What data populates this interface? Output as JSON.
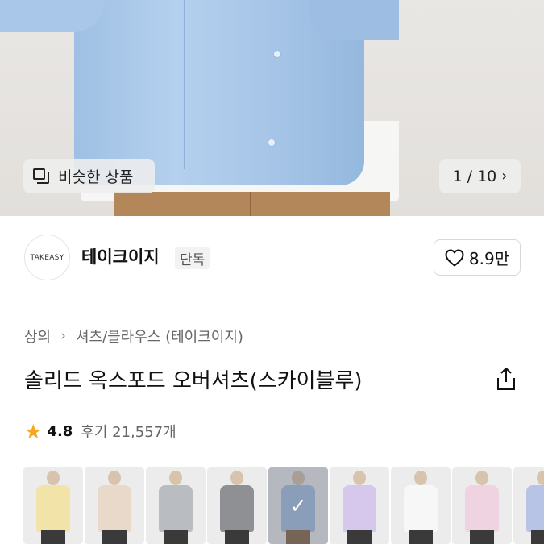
{
  "hero": {
    "similar_label": "비슷한 상품",
    "page_counter": "1 / 10"
  },
  "brand": {
    "logo_text": "TAKEASY",
    "name": "테이크이지",
    "badge": "단독",
    "likes": "8.9만"
  },
  "breadcrumb": [
    "상의",
    "셔츠/블라우스 (테이크이지)"
  ],
  "product": {
    "title": "솔리드 옥스포드 오버셔츠(스카이블루)"
  },
  "rating": {
    "value": "4.8",
    "review_text": "후기 21,557개"
  },
  "colors": {
    "accent_star": "#f5a623",
    "variants": [
      {
        "swatch": "#f2e3a8",
        "legs": "#3a3a3a",
        "selected": false
      },
      {
        "swatch": "#e9d9cb",
        "legs": "#3a3a3a",
        "selected": false
      },
      {
        "swatch": "#b9bdc2",
        "legs": "#3a3a3a",
        "selected": false
      },
      {
        "swatch": "#8e9093",
        "legs": "#3a3a3a",
        "selected": false
      },
      {
        "swatch": "#a9c3e3",
        "legs": "#8b6a4a",
        "selected": true
      },
      {
        "swatch": "#d6c8ec",
        "legs": "#3a3a3a",
        "selected": false
      },
      {
        "swatch": "#f7f7f7",
        "legs": "#3a3a3a",
        "selected": false
      },
      {
        "swatch": "#efd3e0",
        "legs": "#3a3a3a",
        "selected": false
      },
      {
        "swatch": "#b7c4e6",
        "legs": "#3a3a3a",
        "selected": false
      }
    ]
  },
  "icons": {
    "similar": "similar-products-icon",
    "chevron": "chevron-right-icon",
    "heart": "heart-icon",
    "share": "share-icon",
    "star": "star-icon",
    "check": "check-icon"
  }
}
